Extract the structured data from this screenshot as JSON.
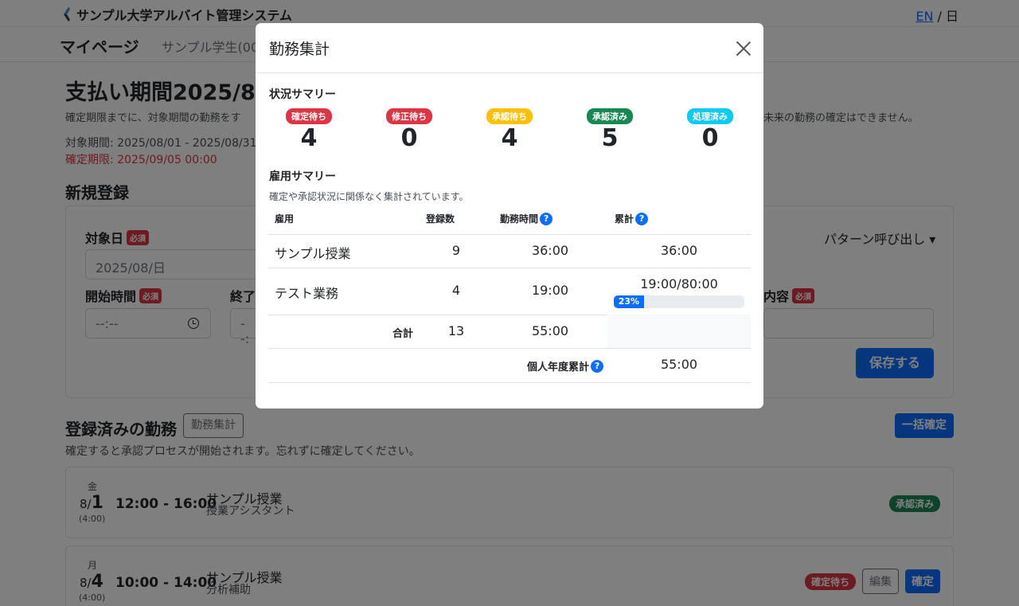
{
  "header": {
    "app_title": "サンプル大学アルバイト管理システム",
    "lang_en": "EN",
    "lang_sep": "/",
    "lang_ja": "日"
  },
  "subnav": {
    "mypage": "マイページ",
    "user": "サンプル学生(00"
  },
  "page": {
    "period_title": "支払い期間2025/8",
    "note_left": "確定期限までに、対象期間の勤務をす",
    "note_right": "未来の勤務の確定はできません。",
    "target_period": "対象期間: 2025/08/01 - 2025/08/31",
    "deadline": "確定期限: 2025/09/05 00:00",
    "new_section": "新規登録"
  },
  "form": {
    "date_label": "対象日",
    "required": "必須",
    "date_value": "2025/08/日",
    "start_label": "開始時間",
    "start_value": "--:--",
    "end_label": "終了",
    "end_value": "--:",
    "content_label": "内容",
    "pattern": "パターン呼び出し ▾",
    "save": "保存する"
  },
  "registered": {
    "title": "登録済みの勤務",
    "summary_button": "勤務集計",
    "bulk_button": "一括確定",
    "note": "確定すると承認プロセスが開始されます。忘れずに確定してください。",
    "shifts": [
      {
        "dow": "金",
        "month": "8/",
        "day": "1",
        "dur": "(4:00)",
        "time": "12:00 - 16:00",
        "job": "サンプル授業",
        "task": "授業アシスタント",
        "status": "承認済み",
        "status_color": "#198754"
      },
      {
        "dow": "月",
        "month": "8/",
        "day": "4",
        "dur": "(4:00)",
        "time": "10:00 - 14:00",
        "job": "サンプル授業",
        "task": "分析補助",
        "status": "確定待ち",
        "status_color": "#dc3545",
        "edit": "編集",
        "confirm": "確定"
      }
    ]
  },
  "modal": {
    "title": "勤務集計",
    "status_summary_title": "状況サマリー",
    "statuses": [
      {
        "label": "確定待ち",
        "count": "4",
        "color": "#dc3545"
      },
      {
        "label": "修正待ち",
        "count": "0",
        "color": "#dc3545"
      },
      {
        "label": "承認待ち",
        "count": "4",
        "color": "#ffc107"
      },
      {
        "label": "承認済み",
        "count": "5",
        "color": "#198754"
      },
      {
        "label": "処理済み",
        "count": "0",
        "color": "#0dcaf0"
      }
    ],
    "employment_summary_title": "雇用サマリー",
    "employment_note": "確定や承認状況に関係なく集計されています。",
    "columns": {
      "employment": "雇用",
      "count": "登録数",
      "hours": "勤務時間",
      "cumulative": "累計",
      "help": "?"
    },
    "rows": [
      {
        "name": "サンプル授業",
        "count": "9",
        "hours": "36:00",
        "cumulative": "36:00"
      },
      {
        "name": "テスト業務",
        "count": "4",
        "hours": "19:00",
        "cumulative": "19:00/80:00",
        "progress_label": "23%",
        "progress": 0.23
      }
    ],
    "total": {
      "label": "合計",
      "count": "13",
      "hours": "55:00"
    },
    "annual": {
      "label": "個人年度累計",
      "value": "55:00"
    }
  }
}
